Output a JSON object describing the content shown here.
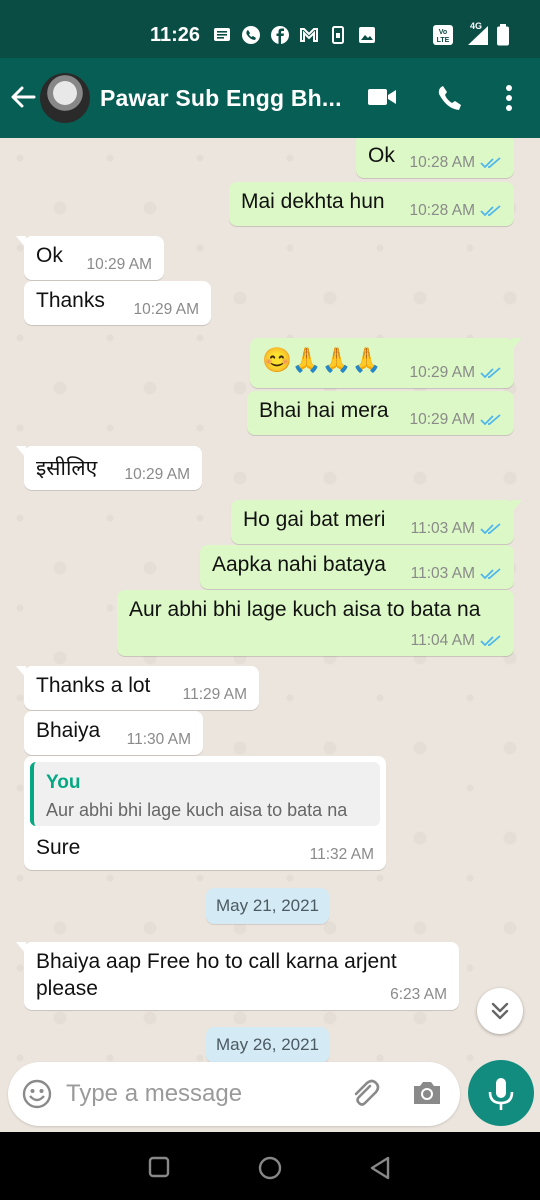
{
  "status_bar": {
    "time": "11:26",
    "icons": [
      "sms-icon",
      "call-icon",
      "facebook-icon",
      "gmail-icon",
      "sim-icon",
      "gallery-icon"
    ],
    "right_icons": [
      "volte-icon",
      "4g-signal-icon",
      "battery-icon"
    ],
    "volte_text": "Vo¹\nLTE",
    "network": "4G"
  },
  "header": {
    "contact_name": "Pawar Sub Engg Bh...",
    "accent": "#075e54"
  },
  "messages": [
    {
      "dir": "out",
      "text": "Ok",
      "time": "10:28 AM"
    },
    {
      "dir": "out",
      "text": "Mai dekhta hun",
      "time": "10:28 AM"
    },
    {
      "dir": "in",
      "text": "Ok",
      "time": "10:29 AM"
    },
    {
      "dir": "in",
      "text": "Thanks",
      "time": "10:29 AM"
    },
    {
      "dir": "out",
      "text": "😊🙏🙏🙏",
      "time": "10:29 AM"
    },
    {
      "dir": "out",
      "text": "Bhai hai mera",
      "time": "10:29 AM"
    },
    {
      "dir": "in",
      "text": "इसीलिए",
      "time": "10:29 AM"
    },
    {
      "dir": "out",
      "text": "Ho gai bat meri",
      "time": "11:03 AM"
    },
    {
      "dir": "out",
      "text": "Aapka nahi bataya",
      "time": "11:03 AM"
    },
    {
      "dir": "out",
      "text": "Aur abhi bhi lage kuch aisa to bata na",
      "time": "11:04 AM"
    },
    {
      "dir": "in",
      "text": "Thanks a lot",
      "time": "11:29 AM"
    },
    {
      "dir": "in",
      "text": "Bhaiya",
      "time": "11:30 AM"
    },
    {
      "dir": "in",
      "text": "Sure",
      "time": "11:32 AM",
      "quote_name": "You",
      "quote_text": "Aur abhi bhi lage kuch aisa to bata na"
    },
    {
      "dir": "in",
      "text_line1": "Bhaiya aap Free ho to call karna arjent",
      "text_line2": "please",
      "time": "6:23 AM"
    }
  ],
  "dates": [
    "May 21, 2021",
    "May 26, 2021"
  ],
  "input": {
    "placeholder": "Type a message"
  },
  "colors": {
    "outgoing_bubble": "#dcf8c6",
    "incoming_bubble": "#ffffff",
    "read_tick": "#4fb6ec",
    "mic_button": "#128c7e"
  }
}
